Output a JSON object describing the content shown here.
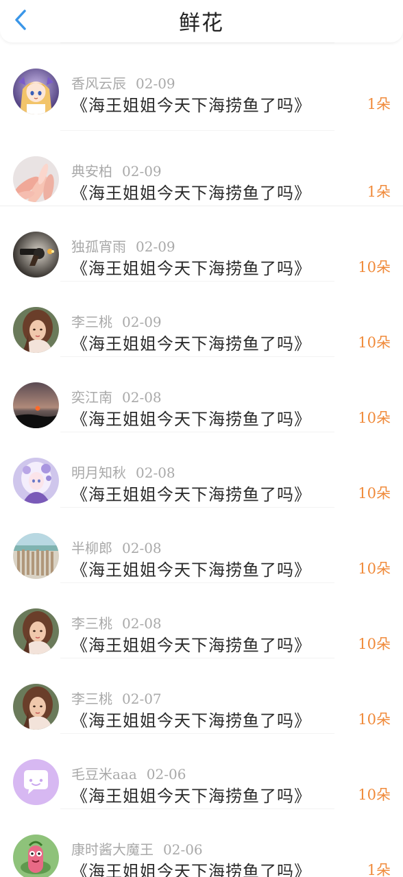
{
  "header": {
    "title": "鲜花",
    "back_icon": "chevron-left-icon",
    "accent": "#3a96e8"
  },
  "colors": {
    "count": "#f08a3a",
    "meta": "#a9a9a9",
    "title": "#2a2a2a"
  },
  "items": [
    {
      "name": "香风云辰",
      "date": "02-09",
      "title": "《海王姐姐今天下海捞鱼了吗》",
      "count": "1朵",
      "avatar": "anime-girl-avatar"
    },
    {
      "name": "典安柏",
      "date": "02-09",
      "title": "《海王姐姐今天下海捞鱼了吗》",
      "count": "1朵",
      "avatar": "flower-petals-avatar"
    },
    {
      "name": "独孤宵雨",
      "date": "02-09",
      "title": "《海王姐姐今天下海捞鱼了吗》",
      "count": "10朵",
      "avatar": "revolver-avatar"
    },
    {
      "name": "李三桃",
      "date": "02-09",
      "title": "《海王姐姐今天下海捞鱼了吗》",
      "count": "10朵",
      "avatar": "woman-portrait-avatar"
    },
    {
      "name": "奕江南",
      "date": "02-08",
      "title": "《海王姐姐今天下海捞鱼了吗》",
      "count": "10朵",
      "avatar": "sunset-avatar"
    },
    {
      "name": "明月知秋",
      "date": "02-08",
      "title": "《海王姐姐今天下海捞鱼了吗》",
      "count": "10朵",
      "avatar": "fantasy-girl-avatar"
    },
    {
      "name": "半柳郎",
      "date": "02-08",
      "title": "《海王姐姐今天下海捞鱼了吗》",
      "count": "10朵",
      "avatar": "beach-fence-avatar"
    },
    {
      "name": "李三桃",
      "date": "02-08",
      "title": "《海王姐姐今天下海捞鱼了吗》",
      "count": "10朵",
      "avatar": "woman-portrait-avatar"
    },
    {
      "name": "李三桃",
      "date": "02-07",
      "title": "《海王姐姐今天下海捞鱼了吗》",
      "count": "10朵",
      "avatar": "woman-portrait-avatar"
    },
    {
      "name": "毛豆米aaa",
      "date": "02-06",
      "title": "《海王姐姐今天下海捞鱼了吗》",
      "count": "10朵",
      "avatar": "chat-bubble-avatar"
    },
    {
      "name": "康时酱大魔王",
      "date": "02-06",
      "title": "《海王姐姐今天下海捞鱼了吗》",
      "count": "1朵",
      "avatar": "cartoon-character-avatar"
    }
  ]
}
